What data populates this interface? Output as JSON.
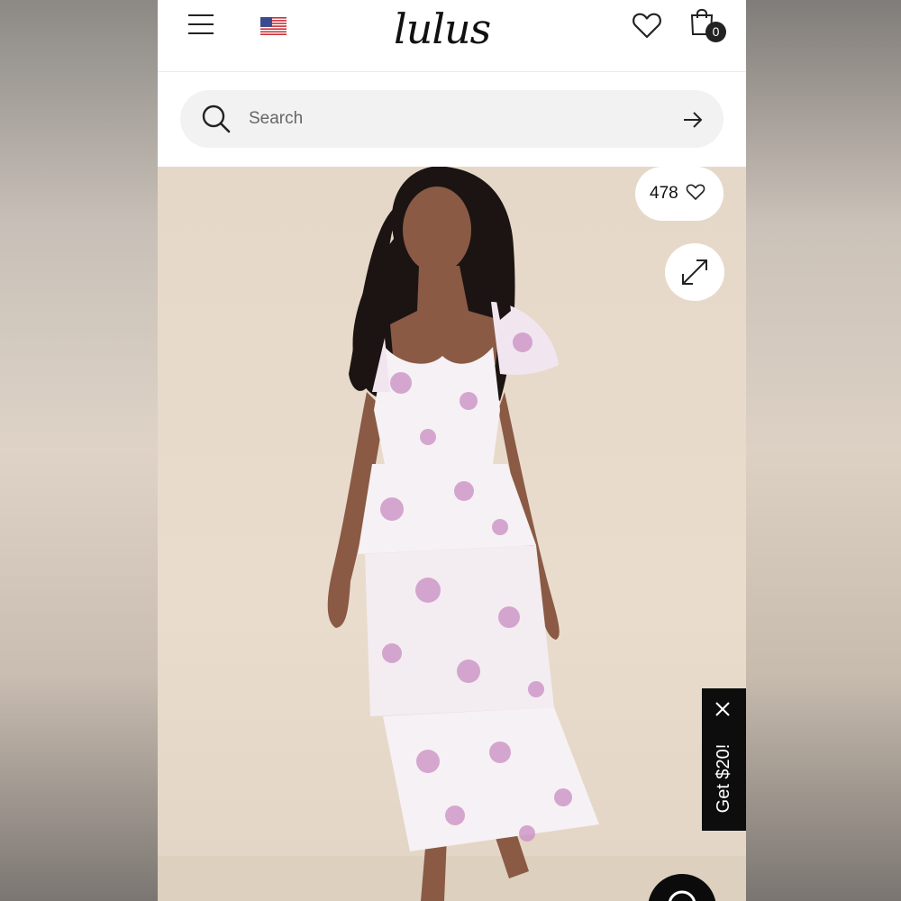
{
  "header": {
    "logo_text": "lulus",
    "menu_icon": "hamburger-menu-icon",
    "flag_icon": "us-flag-icon",
    "wishlist_icon": "heart-icon",
    "bag_icon": "shopping-bag-icon",
    "bag_count": "0"
  },
  "search": {
    "placeholder": "Search",
    "icon": "search-icon",
    "submit_icon": "arrow-right-icon"
  },
  "product_image": {
    "likes_count": "478",
    "like_icon": "heart-outline-icon",
    "expand_icon": "expand-arrows-icon",
    "dress_colors": {
      "background": "#e7d9ca",
      "dress_base": "#f6f1f4",
      "floral": "#c98ec3",
      "hair": "#1b1412",
      "skin": "#8a5a45"
    }
  },
  "promo": {
    "label": "Get $20!",
    "close_icon": "close-icon"
  },
  "chat": {
    "icon": "chat-bubble-icon"
  },
  "colors": {
    "header_bg": "#ffffff",
    "search_bg": "#f2f2f2",
    "promo_bg": "#0d0d0d",
    "text_dark": "#111111"
  }
}
